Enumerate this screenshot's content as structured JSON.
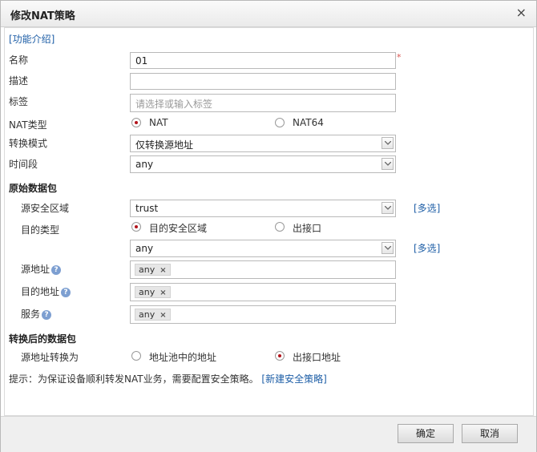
{
  "dialog": {
    "title": "修改NAT策略",
    "close_icon": "×",
    "feature_intro": "[功能介绍]",
    "name_label": "名称",
    "name_value": "01",
    "required_mark": "*",
    "desc_label": "描述",
    "desc_value": "",
    "tag_label": "标签",
    "tag_placeholder": "请选择或输入标签",
    "nat_type_label": "NAT类型",
    "nat_type_options": [
      "NAT",
      "NAT64"
    ],
    "nat_type_selected": "NAT",
    "mode_label": "转换模式",
    "mode_value": "仅转换源地址",
    "time_label": "时间段",
    "time_value": "any"
  },
  "original_packet": {
    "heading": "原始数据包",
    "src_zone_label": "源安全区域",
    "src_zone_value": "trust",
    "multi_select": "[多选]",
    "dst_type_label": "目的类型",
    "dst_type_options": [
      "目的安全区域",
      "出接口"
    ],
    "dst_type_selected": "目的安全区域",
    "dst_zone_value": "any",
    "src_addr_label": "源地址",
    "src_addr_tag": "any",
    "dst_addr_label": "目的地址",
    "dst_addr_tag": "any",
    "service_label": "服务",
    "service_tag": "any",
    "help_icon": "?",
    "tag_remove": "×"
  },
  "translated_packet": {
    "heading": "转换后的数据包",
    "src_translate_label": "源地址转换为",
    "options": [
      "地址池中的地址",
      "出接口地址"
    ],
    "selected": "出接口地址"
  },
  "hint": {
    "text": "提示：为保证设备顺利转发NAT业务，需要配置安全策略。",
    "link": "[新建安全策略]"
  },
  "footer": {
    "ok": "确定",
    "cancel": "取消"
  },
  "colors": {
    "accent_link": "#1f5fa7",
    "radio_selected": "#b3141b",
    "required": "#d9534f"
  }
}
